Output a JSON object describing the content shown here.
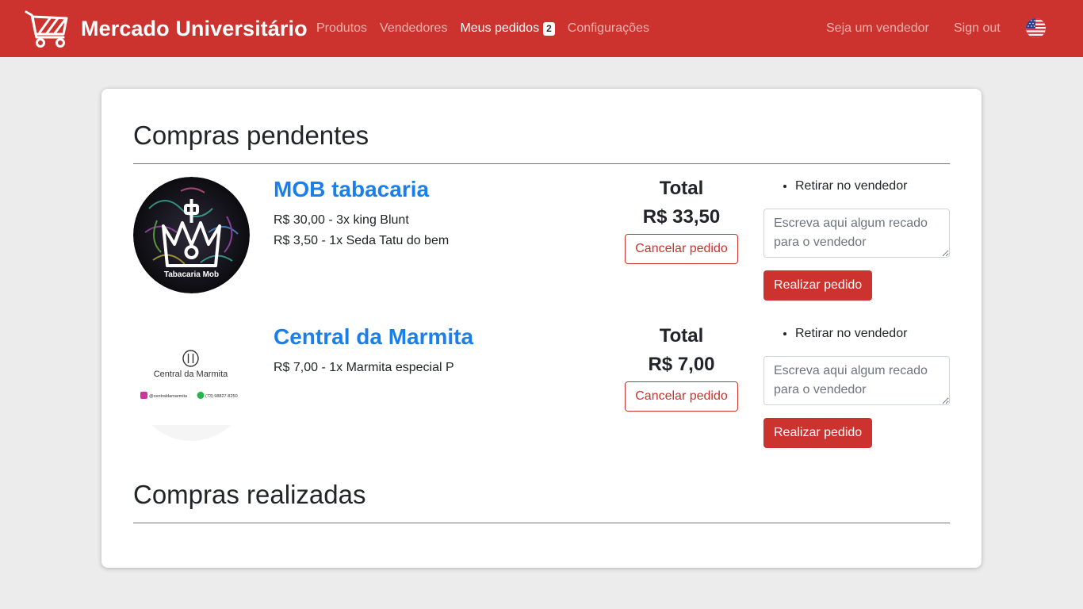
{
  "app": {
    "title": "Mercado Universitário",
    "brand_color": "#cc332e",
    "link_color": "#1a7fea"
  },
  "nav": {
    "links": [
      {
        "label": "Produtos"
      },
      {
        "label": "Vendedores"
      },
      {
        "label": "Meus pedidos",
        "badge": "2",
        "active": true
      },
      {
        "label": "Configurações"
      }
    ],
    "right": {
      "become_seller": "Seja um vendedor",
      "sign_out": "Sign out",
      "language_icon": "us-flag-icon"
    }
  },
  "pending": {
    "title": "Compras pendentes",
    "orders": [
      {
        "shop": "MOB tabacaria",
        "logo_caption": "Tabacaria Mob",
        "items": [
          "R$ 30,00 - 3x king Blunt",
          "R$ 3,50 - 1x Seda Tatu do bem"
        ],
        "total_label": "Total",
        "total": "R$ 33,50",
        "cancel_label": "Cancelar pedido",
        "delivery": "Retirar no vendedor",
        "note_placeholder": "Escreva aqui algum recado para o vendedor",
        "submit_label": "Realizar pedido"
      },
      {
        "shop": "Central da Marmita",
        "logo_caption": "Central da Marmita",
        "logo_handle": "@centraldamarmita",
        "logo_phone": "(73) 98827-8250",
        "items": [
          "R$ 7,00 - 1x Marmita especial P"
        ],
        "total_label": "Total",
        "total": "R$ 7,00",
        "cancel_label": "Cancelar pedido",
        "delivery": "Retirar no vendedor",
        "note_placeholder": "Escreva aqui algum recado para o vendedor",
        "submit_label": "Realizar pedido"
      }
    ]
  },
  "completed": {
    "title": "Compras realizadas"
  }
}
